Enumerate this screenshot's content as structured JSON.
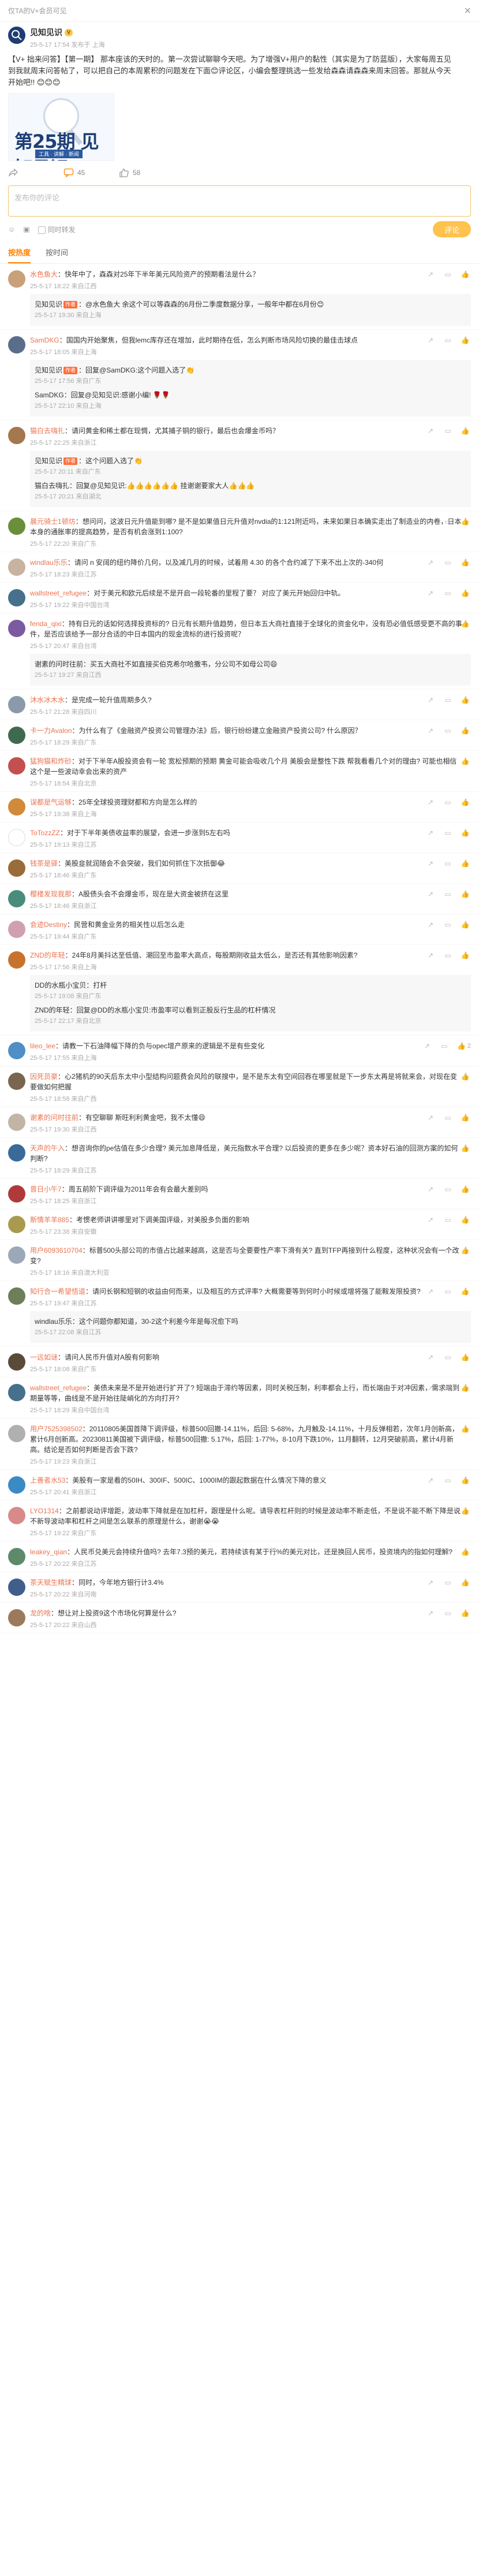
{
  "topbar": {
    "left_text": "仅TA的V+会员可见",
    "close_glyph": "×"
  },
  "post": {
    "author": "见知见识",
    "author_badge": "V",
    "meta": "25-5-17 17:54 发布于 上海",
    "body": "【V+ 拙来问答】【第一期】 那本座该的天时的。第一次尝试聊聊今天吧。为了增强V+用户的黏性（其实是为了防蓝版），大家每周五见到我就周末问答帖了，可以把自己的本周累积的问题发在下面😊评论区，小编会整理挑选一些发给森森请森森来周末回答。那就从今天开始吧!! 😊😊😊",
    "image_big_text": "第25期 见知见识",
    "image_small_text": "工具 · 讲解 · 新闻",
    "actions": {
      "share_count": "",
      "comment_count": "45",
      "like_count": "58"
    }
  },
  "composer": {
    "placeholder": "发布你的评论",
    "also_repost_label": "同时转发",
    "submit_label": "评论"
  },
  "tabs": [
    {
      "label": "按热度",
      "active": true
    },
    {
      "label": "按时间",
      "active": false
    }
  ],
  "comments": [
    {
      "name": "水色鱼大",
      "tag": "",
      "text": "快年中了，森森对25年下半年美元风险资产的预期看法是什么？",
      "meta": "25-5-17 18:22 来自江西",
      "likes": "",
      "avatar_color": "#c8a07a",
      "replies": [
        {
          "name": "见知见识",
          "tag": "作者",
          "text": "@水色鱼大 余这个可以等森森的6月份二季度数据分享，一般年中都在6月份😊",
          "meta": "25-5-17 19:30 来自上海"
        }
      ]
    },
    {
      "name": "SamDKG",
      "tag": "",
      "text": "国国内开始聚焦，但我lemc库存还在增加，此时期待在低，怎么判断市场风险切换的最佳击球点",
      "meta": "25-5-17 18:05 来自上海",
      "likes": "",
      "avatar_color": "#5a6d8a",
      "replies": [
        {
          "name": "见知见识",
          "tag": "作者",
          "text": "回复@SamDKG:这个问题入选了👏",
          "meta": "25-5-17 17:56 来自广东"
        },
        {
          "name": "SamDKG",
          "tag": "",
          "text": "回复@见知见识:感谢小编! 🌹🌹",
          "meta": "25-5-17 22:10 来自上海"
        }
      ]
    },
    {
      "name": "猫白去嗨扎",
      "tag": "",
      "text": "请问黄金和稀土都在现惆，尤其捕子铜的银行，最后也会爆金币吗？",
      "meta": "25-5-17 22:25 来自浙江",
      "likes": "",
      "avatar_color": "#a3784e",
      "replies": [
        {
          "name": "见知见识",
          "tag": "作者",
          "text": "这个问题入选了👏",
          "meta": "25-5-17 20:11 来自广东"
        },
        {
          "name": "猫白去嗨扎",
          "tag": "",
          "text": "回复@见知见识:👍👍👍👍👍👍 挂谢谢要家大人👍👍👍",
          "meta": "25-5-17 20:21 来自湖北"
        }
      ]
    },
    {
      "name": "晨元骑士1顿坊",
      "tag": "",
      "text": "想问问，这波日元升值能到哪? 是不是如果值日元升值对nvdia的1:121附近吗，未来如果日本确实走出了制造业的内卷，日本本身的通胀率的提高趋势，是否有机会涨到1:100?",
      "meta": "25-5-17 22:20 来自广东",
      "likes": "",
      "avatar_color": "#6a8e3a",
      "replies": []
    },
    {
      "name": "windlau乐乐",
      "tag": "",
      "text": "请问 n 安阔的纽约降价几何，以及减几月的时候，试着用 4.30 的各个合约减了下来不出上次的-340何",
      "meta": "25-5-17 18:23 来自江苏",
      "likes": "",
      "avatar_color": "#c7b3a0",
      "replies": []
    },
    {
      "name": "wallstreet_refugee",
      "tag": "",
      "text": "对于美元和欧元后续是不是开启一段轮番的里程了要？ 对应了美元开始回归中轨。",
      "meta": "25-5-17 19:22 来自中国台湾",
      "likes": "",
      "avatar_color": "#46708c",
      "replies": []
    },
    {
      "name": "fenda_qixi",
      "tag": "",
      "text": "持有日元的话如何选择投资标的? 日元有长期升值趋势，但日本五大商社直接于全球化的资金化中，没有恐必值低感受更不高的事件，是否应该给予一部分合适的中日本国内的现金流标的进行投资呢？",
      "meta": "25-5-17 20:47 来自台湾",
      "likes": "",
      "avatar_color": "#7c5aa0",
      "replies": [
        {
          "name": "谢素的问时往前",
          "tag": "",
          "text": "买五大商社不如直接买伯克希尔哈撒韦，分公司不如母公司😄",
          "meta": "25-5-17 19:27 来自江西"
        }
      ]
    },
    {
      "name": "沐水冰木水",
      "tag": "",
      "text": "是完成一轮升值周期多久?",
      "meta": "25-5-17 21:28 来自四川",
      "likes": "",
      "avatar_color": "#8a9aa8",
      "replies": []
    },
    {
      "name": "卡一力Avalon",
      "tag": "",
      "text": "为什么有了《金融资产投资公司管理办法》后，银行纷纷建立金融资产投资公司? 什么原因？",
      "meta": "25-5-17 18:29 来自广东",
      "likes": "",
      "avatar_color": "#3f6a4e",
      "replies": []
    },
    {
      "name": "猛狗猫和炸砂",
      "tag": "",
      "text": "对于下半年A股投资会有一轮 宽松预期的预期 黄金可能会吸收几个月 美股会是整性下跌 帮我看看几个对的理由? 可能也相信这个是一些波动幸会出来的资产",
      "meta": "25-5-17 18:54 来自北京",
      "likes": "",
      "avatar_color": "#c44f4f",
      "replies": []
    },
    {
      "name": "误都是气运够",
      "tag": "",
      "text": "25年全球投资理财都和方向是怎么样的",
      "meta": "25-5-17 19:38 来自上海",
      "likes": "",
      "avatar_color": "#d08a3a",
      "replies": []
    },
    {
      "name": "ToTozzZZ",
      "tag": "",
      "text": "对于下半年美债收益率的展望，会进一步涨到5左右吗",
      "meta": "25-5-17 19:13 来自江苏",
      "likes": "",
      "avatar_color": "#ffffff",
      "replies": []
    },
    {
      "name": "钱茶是驿",
      "tag": "",
      "text": "美股韭就润随会不会突破，我们如何抓住下次抵御😂",
      "meta": "25-5-17 18:46 来自广东",
      "likes": "",
      "avatar_color": "#9a6c3a",
      "replies": []
    },
    {
      "name": "樱楼发现我那",
      "tag": "",
      "text": "A股债头会不会爆金币，现在是大资金被挤在这里",
      "meta": "25-5-17 18:46 来自浙江",
      "likes": "",
      "avatar_color": "#4a8c7c",
      "replies": []
    },
    {
      "name": "会迹Destiny",
      "tag": "",
      "text": "民营和黄金业务的相关性以后怎么走",
      "meta": "25-5-17 19:44 来自广东",
      "likes": "",
      "avatar_color": "#d0a0b0",
      "replies": []
    },
    {
      "name": "ZND的年轻",
      "tag": "",
      "text": "24年8月美抖达至低值、潮回至市盈率大高点，每股期刚收益太低么，是否还有其他影响因素?",
      "meta": "25-5-17 17:56 来自上海",
      "likes": "",
      "avatar_color": "#c7732e",
      "replies": [
        {
          "name": "DD的水瓶小宝贝",
          "tag": "",
          "text": "打杆",
          "meta": "25-5-17 19:08 来自广东"
        },
        {
          "name": "ZND的年轻",
          "tag": "",
          "text": "回复@DD的水瓶小宝贝:市盈率可以看到正股反行生品的杠杆情况",
          "meta": "25-5-17 22:17 来自北京"
        }
      ]
    },
    {
      "name": "lileo_lee",
      "tag": "",
      "text": "请教一下石油降幅下降的负与opec增产原来的逻辑是不是有些变化",
      "meta": "25-5-17 17:55 来自上海",
      "likes": "2",
      "avatar_color": "#4f8fc6",
      "replies": []
    },
    {
      "name": "因死员豪",
      "tag": "",
      "text": "心2猪机的90天后东太中小型结构问题费会风险的联搜中，是不是东太有空间回吞在哪里就是下一步东太再是将就来会，对现在变要做如何把握",
      "meta": "25-5-17 18:58 来自广西",
      "likes": "",
      "avatar_color": "#7a6650",
      "replies": []
    },
    {
      "name": "谢素的问时往前",
      "tag": "",
      "text": "有空聊聊 斯旺利利黄金吧，我不太懂😄",
      "meta": "25-5-17 19:30 来自江西",
      "likes": "",
      "avatar_color": "#c2b5a6",
      "replies": []
    },
    {
      "name": "天声的午入",
      "tag": "",
      "text": "想咨询你的pe估值在多少合理? 美元加息降低是，美元指数水平合理? 以后投资的更多在多少呢？资本好石油的回测方案的如何判断?",
      "meta": "25-5-17 18:29 来自江苏",
      "likes": "",
      "avatar_color": "#3a6a9a",
      "replies": []
    },
    {
      "name": "曾日小午7",
      "tag": "",
      "text": "周五前阶下调评级为2011年会有会最大差别吗",
      "meta": "25-5-17 18:25 来自浙江",
      "likes": "",
      "avatar_color": "#b03a3a",
      "replies": []
    },
    {
      "name": "斯情羊羊885",
      "tag": "",
      "text": "考惯老师讲讲哪里对下调美国评级，对美股多负面的影响",
      "meta": "25-5-17 23:38 来自安徽",
      "likes": "",
      "avatar_color": "#aa9a50",
      "replies": []
    },
    {
      "name": "用户6093610704",
      "tag": "",
      "text": "标普500头部公司的市值占比越来越高，这是否与全要要性产率下滑有关? 直到TFP再接到什么程度，这种状况会有一个改变?",
      "meta": "25-5-17 18:16 来自澳大利亚",
      "likes": "",
      "avatar_color": "#9aa8b8",
      "replies": []
    },
    {
      "name": "知行合一希望悟道",
      "tag": "",
      "text": "请问长钢和短钢的收益由何而来，以及相互的方式评率? 大概需要等到何时小时候或增将强了能鞍发限投资?",
      "meta": "25-5-17 19:47 来自江苏",
      "likes": "",
      "avatar_color": "#6d7e58",
      "replies": [
        {
          "name": "windlau乐乐",
          "tag": "",
          "text": "这个问题你都知道，30-2这个利差今年是每况愈下吗",
          "meta": "25-5-17 22:08 来自江苏"
        }
      ]
    },
    {
      "name": "一远如谜",
      "tag": "",
      "text": "请问人民币升值对A股有何影响",
      "meta": "25-5-17 18:08 来自广东",
      "likes": "",
      "avatar_color": "#5a4a3a",
      "replies": []
    },
    {
      "name": "wallstreet_refugee",
      "tag": "",
      "text": "美债未来是不是开始进行扩开了? 短端由于滞约等因素，同时关税压制，利率都会上行，而长端由于对冲因素，需求端到期量等等，曲线是不是开始往陡峭化的方向打开?",
      "meta": "25-5-17 18:29 来自中国台湾",
      "likes": "",
      "avatar_color": "#46708c",
      "replies": []
    },
    {
      "name": "用户7525398502",
      "tag": "",
      "text": "20110805美国首降下调评级，标普500回撤-14.11%，后回: 5-68%，九月触及-14.11%，十月反弹相若，次年1月创新高，累计6月创新高。20230811美国被下调评级，标普500回撤: 5.17%，后回: 1-77%，8-10月下跌10%，11月翻转，12月突破前高，累计4月新高。结论是否如何判断是否会下跌?",
      "meta": "25-5-17 19:23 来自浙江",
      "likes": "",
      "avatar_color": "#b0b0b0",
      "replies": []
    },
    {
      "name": "上善者水53",
      "tag": "",
      "text": "美股有一家是看的50IH、300IF、500IC、1000IM的跟起数据在什么情况下降的意义",
      "meta": "25-5-17 20:41 来自浙江",
      "likes": "",
      "avatar_color": "#3a8ac4",
      "replies": []
    },
    {
      "name": "LYO1314",
      "tag": "",
      "text": "之前都说动评增距，波动率下降就是在加杠杆，跟理是什么呢。请导表杠杆则的时候是波动率不断走低，不是说不能不断下降是说不新导波动率和杠杆之间是怎么联系的原理是什么，谢谢😭😭",
      "meta": "25-5-17 19:22 来自广东",
      "likes": "",
      "avatar_color": "#d88a8a",
      "replies": []
    },
    {
      "name": "leakey_qian",
      "tag": "",
      "text": "人民币兑美元会持续升值吗? 去年7.3预的美元，若持续该有某于行%的美元对比，还是换回人民币，投资境内的指如何理解?",
      "meta": "25-5-17 20:22 来自江苏",
      "likes": "",
      "avatar_color": "#5e8a6a",
      "replies": []
    },
    {
      "name": "茶天赋生精球",
      "tag": "",
      "text": "同时，今年地方银行计3.4%",
      "meta": "25-5-17 20:22 来自河南",
      "likes": "",
      "avatar_color": "#3f5f8a",
      "replies": []
    },
    {
      "name": "龙的啥",
      "tag": "",
      "text": "想让对上投资9这个市场化何算是什么?",
      "meta": "25-5-17 20:22 来自山西",
      "likes": "",
      "avatar_color": "#9a7a5a",
      "replies": []
    }
  ]
}
